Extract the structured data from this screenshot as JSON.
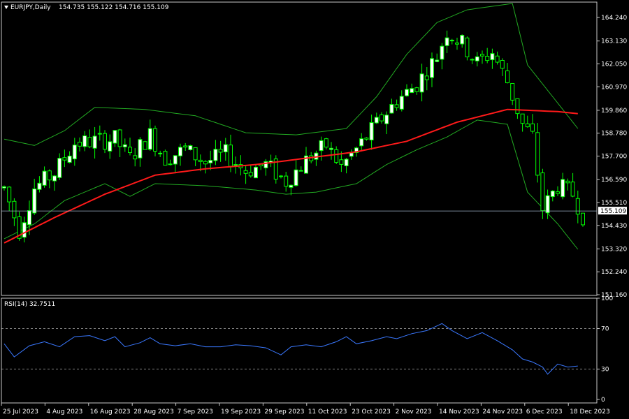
{
  "header": {
    "symbol_timeframe": "EURJPY,Daily",
    "ohlc": "154.735 155.122 154.716 155.109"
  },
  "rsi_panel": {
    "label": "RSI(14) 32.7511"
  },
  "price_tag": "155.109",
  "colors": {
    "background": "#000000",
    "frame": "#c8c8c8",
    "bull_candle": "#ffffff",
    "bear_candle": "#000000",
    "wick": "#00ff00",
    "bollinger": "#22aa22",
    "moving_average": "#ff1a1a",
    "rsi_line": "#3a78ff",
    "rsi_levels": "#b4b4b4",
    "price_line": "#9fb3c8"
  },
  "chart_data": {
    "type": "candlestick",
    "price_axis": {
      "ticks": [
        164.24,
        163.13,
        162.05,
        160.97,
        159.86,
        158.78,
        157.7,
        156.59,
        155.51,
        154.43,
        153.32,
        152.24,
        151.16
      ],
      "tick_labels": [
        "164.240",
        "163.130",
        "162.050",
        "160.970",
        "159.860",
        "158.780",
        "157.700",
        "156.590",
        "155.510",
        "154.430",
        "153.320",
        "152.240",
        "151.160"
      ],
      "range": [
        151.16,
        164.24
      ]
    },
    "rsi_axis": {
      "ticks": [
        100,
        70,
        30,
        0
      ],
      "tick_labels": [
        "100",
        "70",
        "30",
        "0"
      ],
      "levels": [
        70,
        30
      ],
      "range": [
        0,
        100
      ]
    },
    "date_labels": [
      "25 Jul 2023",
      "4 Aug 2023",
      "16 Aug 2023",
      "28 Aug 2023",
      "7 Sep 2023",
      "19 Sep 2023",
      "29 Sep 2023",
      "11 Oct 2023",
      "23 Oct 2023",
      "2 Nov 2023",
      "14 Nov 2023",
      "24 Nov 2023",
      "6 Dec 2023",
      "18 Dec 2023"
    ],
    "last_price": 155.109,
    "price_path": [
      [
        0,
        156.2
      ],
      [
        3,
        154.2
      ],
      [
        6,
        156.2
      ],
      [
        10,
        156.9
      ],
      [
        14,
        158.3
      ],
      [
        18,
        158.4
      ],
      [
        22,
        158.5
      ],
      [
        25,
        157.6
      ],
      [
        29,
        158.7
      ],
      [
        32,
        157.6
      ],
      [
        36,
        158.0
      ],
      [
        40,
        157.4
      ],
      [
        44,
        157.8
      ],
      [
        48,
        157.0
      ],
      [
        52,
        157.3
      ],
      [
        56,
        156.5
      ],
      [
        60,
        157.5
      ],
      [
        64,
        158.2
      ],
      [
        67,
        157.2
      ],
      [
        71,
        158.3
      ],
      [
        75,
        159.5
      ],
      [
        78,
        160.3
      ],
      [
        82,
        161.1
      ],
      [
        86,
        162.4
      ],
      [
        88,
        163.6
      ],
      [
        91,
        163.0
      ],
      [
        94,
        162.1
      ],
      [
        97,
        162.6
      ],
      [
        100,
        161.2
      ],
      [
        103,
        159.2
      ],
      [
        105,
        158.6
      ],
      [
        107,
        155.2
      ],
      [
        110,
        156.3
      ],
      [
        113,
        155.9
      ],
      [
        115,
        154.9
      ]
    ],
    "series": [
      {
        "name": "",
        "kind": "moving_average",
        "points": [
          [
            0,
            153.6
          ],
          [
            10,
            154.8
          ],
          [
            20,
            155.9
          ],
          [
            30,
            156.8
          ],
          [
            40,
            157.1
          ],
          [
            50,
            157.3
          ],
          [
            60,
            157.6
          ],
          [
            70,
            157.9
          ],
          [
            80,
            158.4
          ],
          [
            90,
            159.3
          ],
          [
            100,
            159.9
          ],
          [
            110,
            159.8
          ],
          [
            114,
            159.7
          ]
        ]
      },
      {
        "name": "",
        "kind": "bollinger_upper",
        "points": [
          [
            0,
            158.5
          ],
          [
            6,
            158.2
          ],
          [
            12,
            158.9
          ],
          [
            18,
            160.0
          ],
          [
            28,
            159.9
          ],
          [
            38,
            159.6
          ],
          [
            48,
            158.8
          ],
          [
            58,
            158.7
          ],
          [
            68,
            159.0
          ],
          [
            74,
            160.5
          ],
          [
            80,
            162.5
          ],
          [
            86,
            164.0
          ],
          [
            92,
            164.6
          ],
          [
            98,
            164.8
          ],
          [
            101,
            164.9
          ],
          [
            104,
            162.0
          ],
          [
            110,
            160.2
          ],
          [
            114,
            159.0
          ]
        ]
      },
      {
        "name": "",
        "kind": "bollinger_lower",
        "points": [
          [
            0,
            153.8
          ],
          [
            6,
            154.5
          ],
          [
            12,
            155.6
          ],
          [
            20,
            156.4
          ],
          [
            25,
            155.8
          ],
          [
            30,
            156.4
          ],
          [
            40,
            156.3
          ],
          [
            50,
            156.1
          ],
          [
            56,
            155.9
          ],
          [
            62,
            156.0
          ],
          [
            70,
            156.4
          ],
          [
            76,
            157.3
          ],
          [
            82,
            158.0
          ],
          [
            88,
            158.6
          ],
          [
            94,
            159.4
          ],
          [
            100,
            159.2
          ],
          [
            104,
            156.0
          ],
          [
            110,
            154.5
          ],
          [
            114,
            153.3
          ]
        ]
      }
    ],
    "rsi_points": [
      [
        0,
        55
      ],
      [
        2,
        42
      ],
      [
        5,
        53
      ],
      [
        8,
        57
      ],
      [
        11,
        52
      ],
      [
        14,
        62
      ],
      [
        17,
        63
      ],
      [
        20,
        58
      ],
      [
        22,
        62
      ],
      [
        24,
        52
      ],
      [
        27,
        56
      ],
      [
        29,
        61
      ],
      [
        31,
        55
      ],
      [
        34,
        53
      ],
      [
        37,
        55
      ],
      [
        40,
        52
      ],
      [
        43,
        52
      ],
      [
        46,
        54
      ],
      [
        49,
        53
      ],
      [
        52,
        51
      ],
      [
        55,
        44
      ],
      [
        57,
        52
      ],
      [
        60,
        54
      ],
      [
        63,
        52
      ],
      [
        66,
        57
      ],
      [
        68,
        62
      ],
      [
        70,
        55
      ],
      [
        73,
        58
      ],
      [
        76,
        62
      ],
      [
        78,
        60
      ],
      [
        81,
        65
      ],
      [
        84,
        68
      ],
      [
        87,
        75
      ],
      [
        89,
        68
      ],
      [
        92,
        60
      ],
      [
        95,
        66
      ],
      [
        98,
        58
      ],
      [
        101,
        49
      ],
      [
        103,
        40
      ],
      [
        105,
        37
      ],
      [
        107,
        32
      ],
      [
        108,
        25
      ],
      [
        110,
        35
      ],
      [
        112,
        32
      ],
      [
        114,
        33
      ]
    ]
  }
}
